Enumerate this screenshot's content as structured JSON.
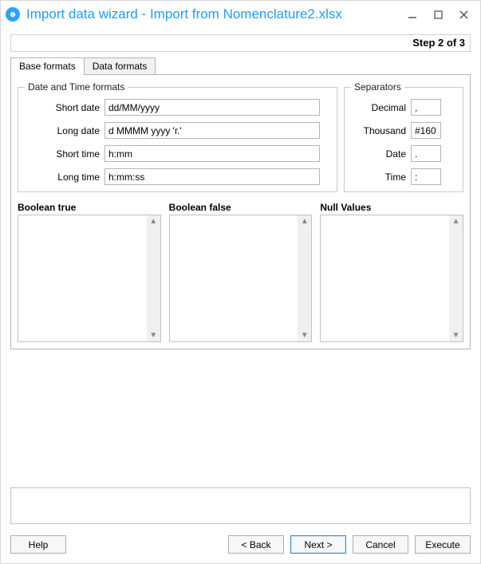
{
  "window": {
    "title": "Import data wizard - Import from Nomenclature2.xlsx",
    "step_text": "Step 2 of 3"
  },
  "tabs": {
    "base_formats": "Base formats",
    "data_formats": "Data formats"
  },
  "datetime": {
    "legend": "Date and Time formats",
    "short_date_label": "Short date",
    "short_date_value": "dd/MM/yyyy",
    "long_date_label": "Long date",
    "long_date_value": "d MMMM yyyy 'г.'",
    "short_time_label": "Short time",
    "short_time_value": "h:mm",
    "long_time_label": "Long time",
    "long_time_value": "h:mm:ss"
  },
  "separators": {
    "legend": "Separators",
    "decimal_label": "Decimal",
    "decimal_value": ",",
    "thousand_label": "Thousand",
    "thousand_value": "#160",
    "date_label": "Date",
    "date_value": ".",
    "time_label": "Time",
    "time_value": ":"
  },
  "lists": {
    "boolean_true": "Boolean true",
    "boolean_false": "Boolean false",
    "null_values": "Null Values"
  },
  "buttons": {
    "help": "Help",
    "back": "< Back",
    "next": "Next >",
    "cancel": "Cancel",
    "execute": "Execute"
  }
}
